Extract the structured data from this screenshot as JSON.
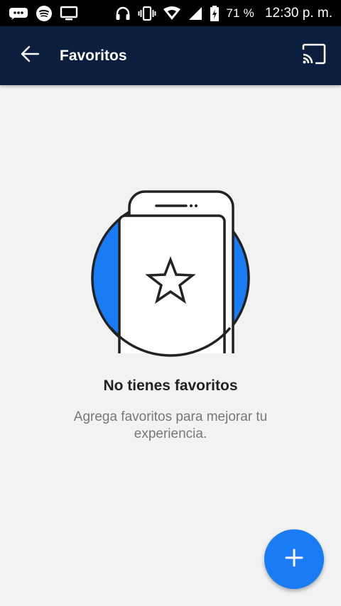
{
  "status_bar": {
    "battery": "71 %",
    "time": "12:30 p. m.",
    "icons": [
      "messages-icon",
      "spotify-icon",
      "screen-icon",
      "headset-icon",
      "vibrate-icon",
      "wifi-icon",
      "signal-icon",
      "battery-icon"
    ]
  },
  "app_bar": {
    "title": "Favoritos",
    "back_icon": "arrow-left-icon",
    "cast_icon": "cast-icon"
  },
  "empty_state": {
    "title": "No tienes favoritos",
    "description": "Agrega favoritos para mejorar tu experiencia.",
    "illustration_icon": "phone-star-icon"
  },
  "fab": {
    "icon": "plus-icon"
  },
  "colors": {
    "app_bar": "#0c1e3d",
    "accent": "#1a7cf5",
    "background": "#f2f2f2"
  }
}
